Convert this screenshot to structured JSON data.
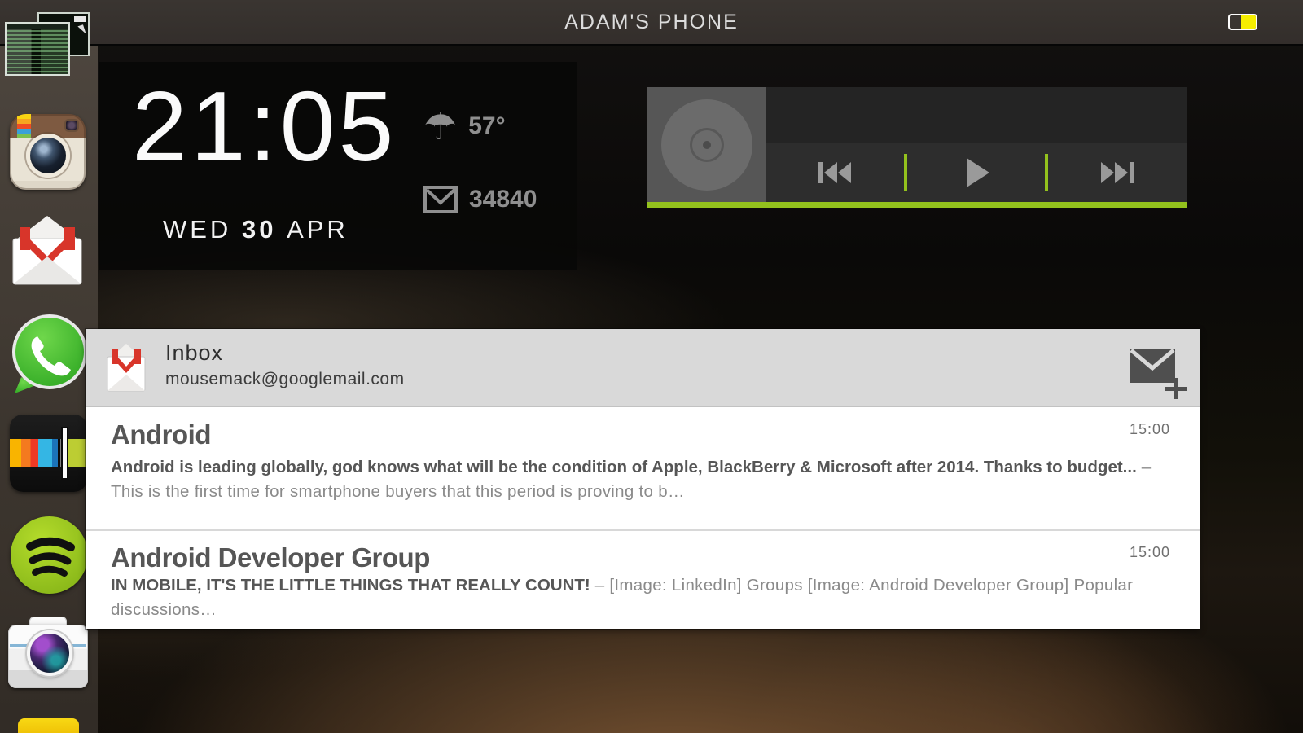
{
  "window": {
    "title": "ADAM'S PHONE"
  },
  "status_bar": {
    "battery_icon": "battery-icon",
    "battery_fill_color": "#f6ee00"
  },
  "colors": {
    "accent_green": "#93c11d",
    "gmail_red": "#d8352a",
    "header_gray": "#d9d9d9",
    "topbar_dark": "#332e2b"
  },
  "sidebar": {
    "apps": [
      {
        "icon": "terminal-monitor-icon"
      },
      {
        "icon": "instagram-icon"
      },
      {
        "icon": "gmail-icon"
      },
      {
        "icon": "whatsapp-icon"
      },
      {
        "icon": "stripes-media-app-icon"
      },
      {
        "icon": "spotify-icon"
      },
      {
        "icon": "camera-app-icon"
      },
      {
        "icon": "yellow-app-icon"
      }
    ]
  },
  "clock_widget": {
    "time": "21:05",
    "date_day": "WED",
    "date_num": "30",
    "date_month": "APR",
    "weather_icon": "umbrella-icon",
    "weather_temp": "57°",
    "mail_icon": "mail-envelope-icon",
    "mail_count": "34840"
  },
  "music_widget": {
    "art_icon": "cd-disc-icon",
    "controls": [
      {
        "icon": "previous-track-icon"
      },
      {
        "icon": "play-icon"
      },
      {
        "icon": "next-track-icon"
      }
    ],
    "progress_color": "#93c11d"
  },
  "gmail_widget": {
    "icon": "gmail-envelope-icon",
    "folder": "Inbox",
    "account": "mousemack@googlemail.com",
    "compose_icon": "compose-email-icon",
    "emails": [
      {
        "sender": "Android",
        "subject": "Android is leading globally, god knows what will be the condition of Apple, BlackBerry & Microsoft after 2014.  Thanks to budget...",
        "snippet": " – This is the first time for smartphone buyers that this period is proving to b…",
        "time": "15:00"
      },
      {
        "sender": "Android Developer Group",
        "subject": "IN MOBILE, IT'S THE LITTLE THINGS THAT REALLY COUNT!",
        "snippet": " – [Image: LinkedIn] Groups [Image: Android Developer Group] Popular discussions…",
        "time": "15:00"
      }
    ]
  }
}
